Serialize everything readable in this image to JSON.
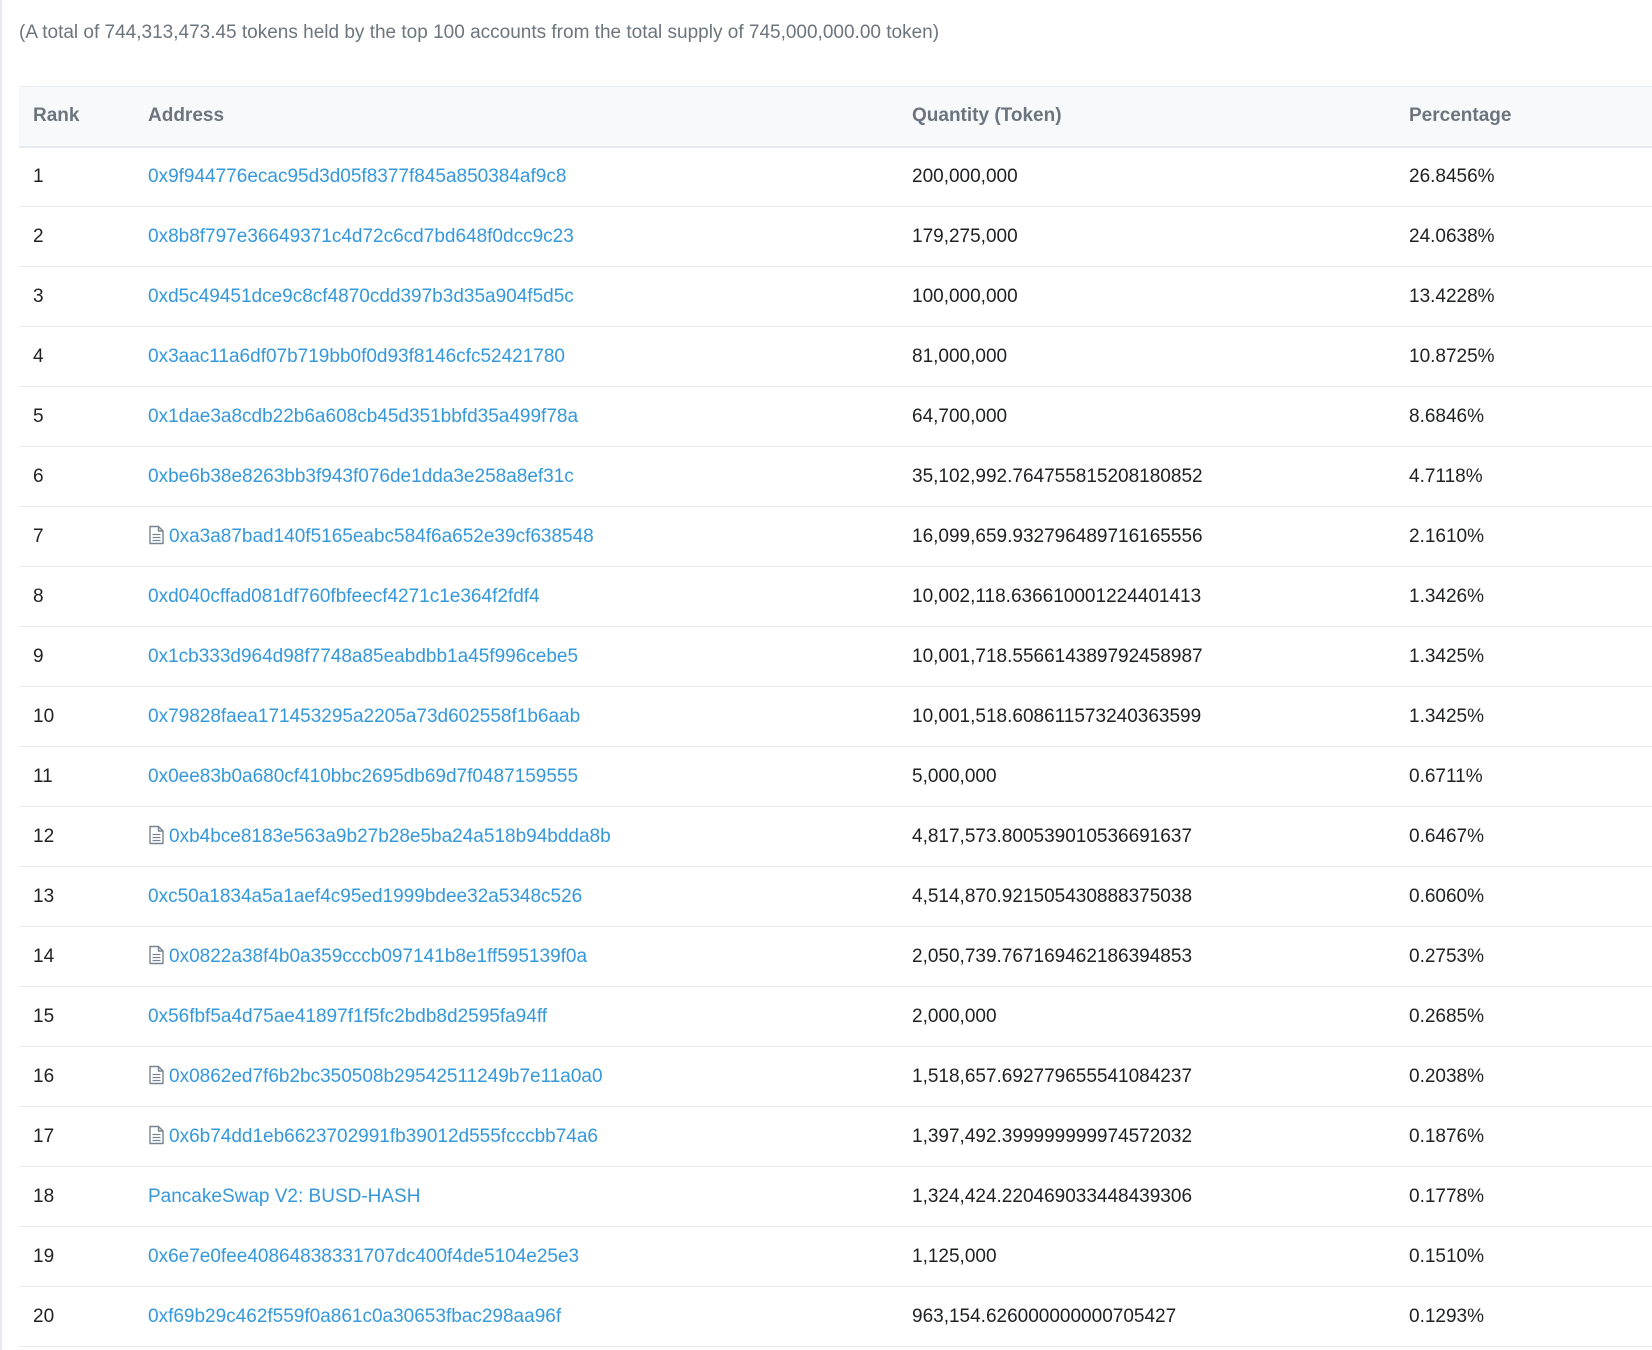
{
  "summary": "(A total of 744,313,473.45 tokens held by the top 100 accounts from the total supply of 745,000,000.00 token)",
  "table": {
    "headers": {
      "rank": "Rank",
      "address": "Address",
      "quantity": "Quantity (Token)",
      "percentage": "Percentage"
    },
    "rows": [
      {
        "rank": "1",
        "address": "0x9f944776ecac95d3d05f8377f845a850384af9c8",
        "contract": false,
        "quantity": "200,000,000",
        "percentage": "26.8456%"
      },
      {
        "rank": "2",
        "address": "0x8b8f797e36649371c4d72c6cd7bd648f0dcc9c23",
        "contract": false,
        "quantity": "179,275,000",
        "percentage": "24.0638%"
      },
      {
        "rank": "3",
        "address": "0xd5c49451dce9c8cf4870cdd397b3d35a904f5d5c",
        "contract": false,
        "quantity": "100,000,000",
        "percentage": "13.4228%"
      },
      {
        "rank": "4",
        "address": "0x3aac11a6df07b719bb0f0d93f8146cfc52421780",
        "contract": false,
        "quantity": "81,000,000",
        "percentage": "10.8725%"
      },
      {
        "rank": "5",
        "address": "0x1dae3a8cdb22b6a608cb45d351bbfd35a499f78a",
        "contract": false,
        "quantity": "64,700,000",
        "percentage": "8.6846%"
      },
      {
        "rank": "6",
        "address": "0xbe6b38e8263bb3f943f076de1dda3e258a8ef31c",
        "contract": false,
        "quantity": "35,102,992.764755815208180852",
        "percentage": "4.7118%"
      },
      {
        "rank": "7",
        "address": "0xa3a87bad140f5165eabc584f6a652e39cf638548",
        "contract": true,
        "quantity": "16,099,659.932796489716165556",
        "percentage": "2.1610%"
      },
      {
        "rank": "8",
        "address": "0xd040cffad081df760fbfeecf4271c1e364f2fdf4",
        "contract": false,
        "quantity": "10,002,118.636610001224401413",
        "percentage": "1.3426%"
      },
      {
        "rank": "9",
        "address": "0x1cb333d964d98f7748a85eabdbb1a45f996cebe5",
        "contract": false,
        "quantity": "10,001,718.556614389792458987",
        "percentage": "1.3425%"
      },
      {
        "rank": "10",
        "address": "0x79828faea171453295a2205a73d602558f1b6aab",
        "contract": false,
        "quantity": "10,001,518.608611573240363599",
        "percentage": "1.3425%"
      },
      {
        "rank": "11",
        "address": "0x0ee83b0a680cf410bbc2695db69d7f0487159555",
        "contract": false,
        "quantity": "5,000,000",
        "percentage": "0.6711%"
      },
      {
        "rank": "12",
        "address": "0xb4bce8183e563a9b27b28e5ba24a518b94bdda8b",
        "contract": true,
        "quantity": "4,817,573.800539010536691637",
        "percentage": "0.6467%"
      },
      {
        "rank": "13",
        "address": "0xc50a1834a5a1aef4c95ed1999bdee32a5348c526",
        "contract": false,
        "quantity": "4,514,870.921505430888375038",
        "percentage": "0.6060%"
      },
      {
        "rank": "14",
        "address": "0x0822a38f4b0a359cccb097141b8e1ff595139f0a",
        "contract": true,
        "quantity": "2,050,739.767169462186394853",
        "percentage": "0.2753%"
      },
      {
        "rank": "15",
        "address": "0x56fbf5a4d75ae41897f1f5fc2bdb8d2595fa94ff",
        "contract": false,
        "quantity": "2,000,000",
        "percentage": "0.2685%"
      },
      {
        "rank": "16",
        "address": "0x0862ed7f6b2bc350508b29542511249b7e11a0a0",
        "contract": true,
        "quantity": "1,518,657.692779655541084237",
        "percentage": "0.2038%"
      },
      {
        "rank": "17",
        "address": "0x6b74dd1eb6623702991fb39012d555fcccbb74a6",
        "contract": true,
        "quantity": "1,397,492.399999999974572032",
        "percentage": "0.1876%"
      },
      {
        "rank": "18",
        "address": "PancakeSwap V2: BUSD-HASH",
        "contract": false,
        "quantity": "1,324,424.220469033448439306",
        "percentage": "0.1778%"
      },
      {
        "rank": "19",
        "address": "0x6e7e0fee40864838331707dc400f4de5104e25e3",
        "contract": false,
        "quantity": "1,125,000",
        "percentage": "0.1510%"
      },
      {
        "rank": "20",
        "address": "0xf69b29c462f559f0a861c0a30653fbac298aa96f",
        "contract": false,
        "quantity": "963,154.626000000000705427",
        "percentage": "0.1293%"
      }
    ]
  },
  "colors": {
    "link": "#3498db",
    "header_text": "#6c757e",
    "body_text": "#1e2022",
    "border": "#e7eaf3",
    "header_bg": "#f8f9fa"
  },
  "icons": {
    "contract": "file-text-icon"
  }
}
